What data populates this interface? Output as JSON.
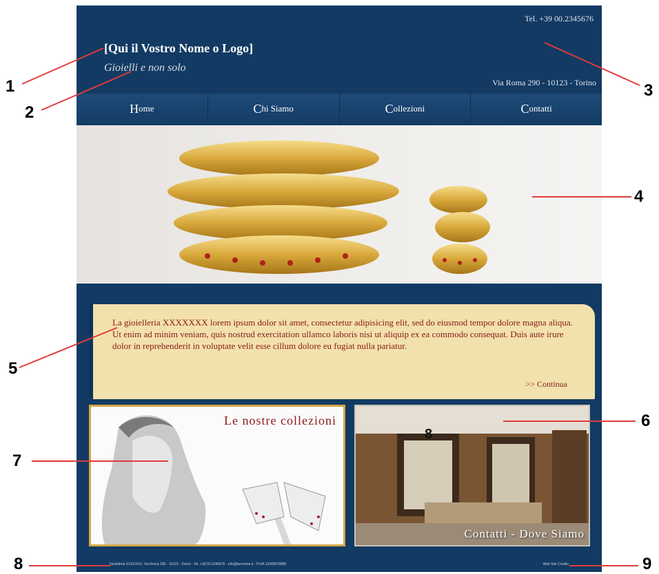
{
  "header": {
    "logo_text": "[Qui il Vostro Nome o Logo]",
    "tagline": "Gioielli e non solo",
    "phone": "Tel. +39 00.2345676",
    "address": "Via Roma 290 - 10123 - Torino"
  },
  "nav": {
    "items": [
      {
        "cap": "H",
        "rest": "ome"
      },
      {
        "cap": "C",
        "rest": "hi Siamo"
      },
      {
        "cap": "C",
        "rest": "ollezioni"
      },
      {
        "cap": "C",
        "rest": "ontatti"
      }
    ]
  },
  "intro": {
    "text": "La gioielleria XXXXXXX lorem ipsum dolor sit amet, consectetur adipisicing elit, sed do eiusmod tempor dolore magna aliqua. Ut enim ad minim veniam, quis nostrud exercitation ullamco laboris nisi ut aliquip ex ea commodo consequat. Duis aute irure dolor in reprehenderit in voluptate velit esse cillum dolore eu fugiat nulla pariatur.",
    "continue_label": ">> Continua"
  },
  "panels": {
    "collections_title": "Le nostre collezioni",
    "contacts_title": "Contatti - Dove Siamo",
    "overlay_number": "8"
  },
  "footer": {
    "text": "Gioielleria XXXXXXX, Via Roma 290 - 10123 - Torino - Tel. +39 00.2345676 - info@tuonome.it - P.IVA 12345678890",
    "credits": "Web Site Credits"
  },
  "annotations": {
    "numbers": [
      "1",
      "2",
      "3",
      "4",
      "5",
      "6",
      "7",
      "8",
      "9"
    ]
  },
  "colors": {
    "site_bg": "#123a63",
    "intro_bg": "#f2e1ac",
    "accent_red": "#8a1a1a",
    "gold": "#d4a843"
  }
}
